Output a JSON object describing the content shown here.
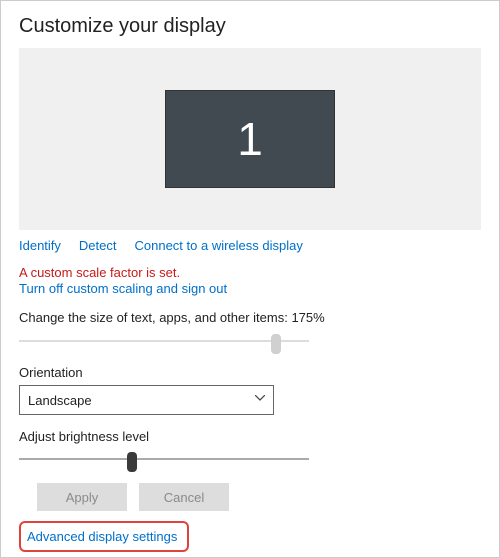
{
  "header": {
    "title": "Customize your display"
  },
  "monitor": {
    "label": "1"
  },
  "links": {
    "identify": "Identify",
    "detect": "Detect",
    "wireless": "Connect to a wireless display"
  },
  "warning": {
    "text": "A custom scale factor is set.",
    "action": "Turn off custom scaling and sign out"
  },
  "scale": {
    "label_prefix": "Change the size of text, apps, and other items: ",
    "value_text": "175%"
  },
  "orientation": {
    "label": "Orientation",
    "value": "Landscape"
  },
  "brightness": {
    "label": "Adjust brightness level"
  },
  "buttons": {
    "apply": "Apply",
    "cancel": "Cancel"
  },
  "advanced": {
    "label": "Advanced display settings"
  }
}
